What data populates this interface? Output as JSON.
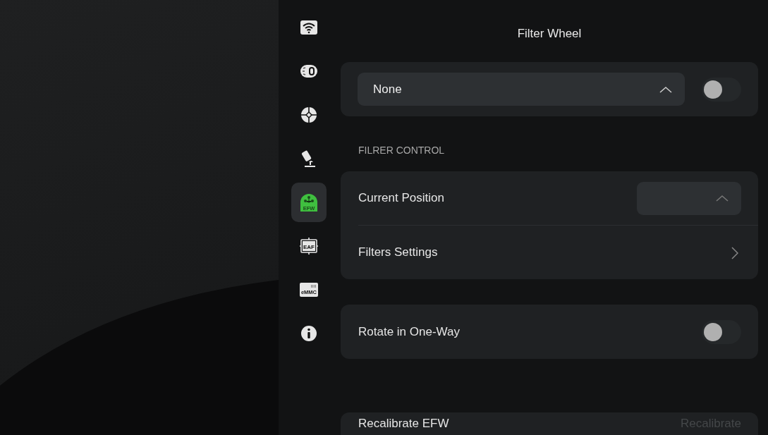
{
  "sidebar": {
    "items": [
      {
        "kind": "wifi",
        "selected": false
      },
      {
        "kind": "camera",
        "selected": false
      },
      {
        "kind": "guide",
        "selected": false
      },
      {
        "kind": "mount",
        "selected": false
      },
      {
        "kind": "efw",
        "label": "EFW",
        "selected": true
      },
      {
        "kind": "eaf",
        "label": "EAF",
        "selected": false
      },
      {
        "kind": "emmc",
        "label": "eMMC",
        "selected": false
      },
      {
        "kind": "info",
        "selected": false
      }
    ]
  },
  "title": "Filter Wheel",
  "device": {
    "value": "None",
    "on": false
  },
  "section_label": "FILRER CONTROL",
  "filter_control": [
    {
      "kind": "dropdown",
      "label": "Current Position"
    },
    {
      "kind": "link",
      "label": "Filters Settings"
    }
  ],
  "rotate_one_way": {
    "label": "Rotate in One-Way",
    "on": false
  },
  "recalibrate": {
    "label": "Recalibrate EFW",
    "button": "Recalibrate",
    "disabled": true
  }
}
